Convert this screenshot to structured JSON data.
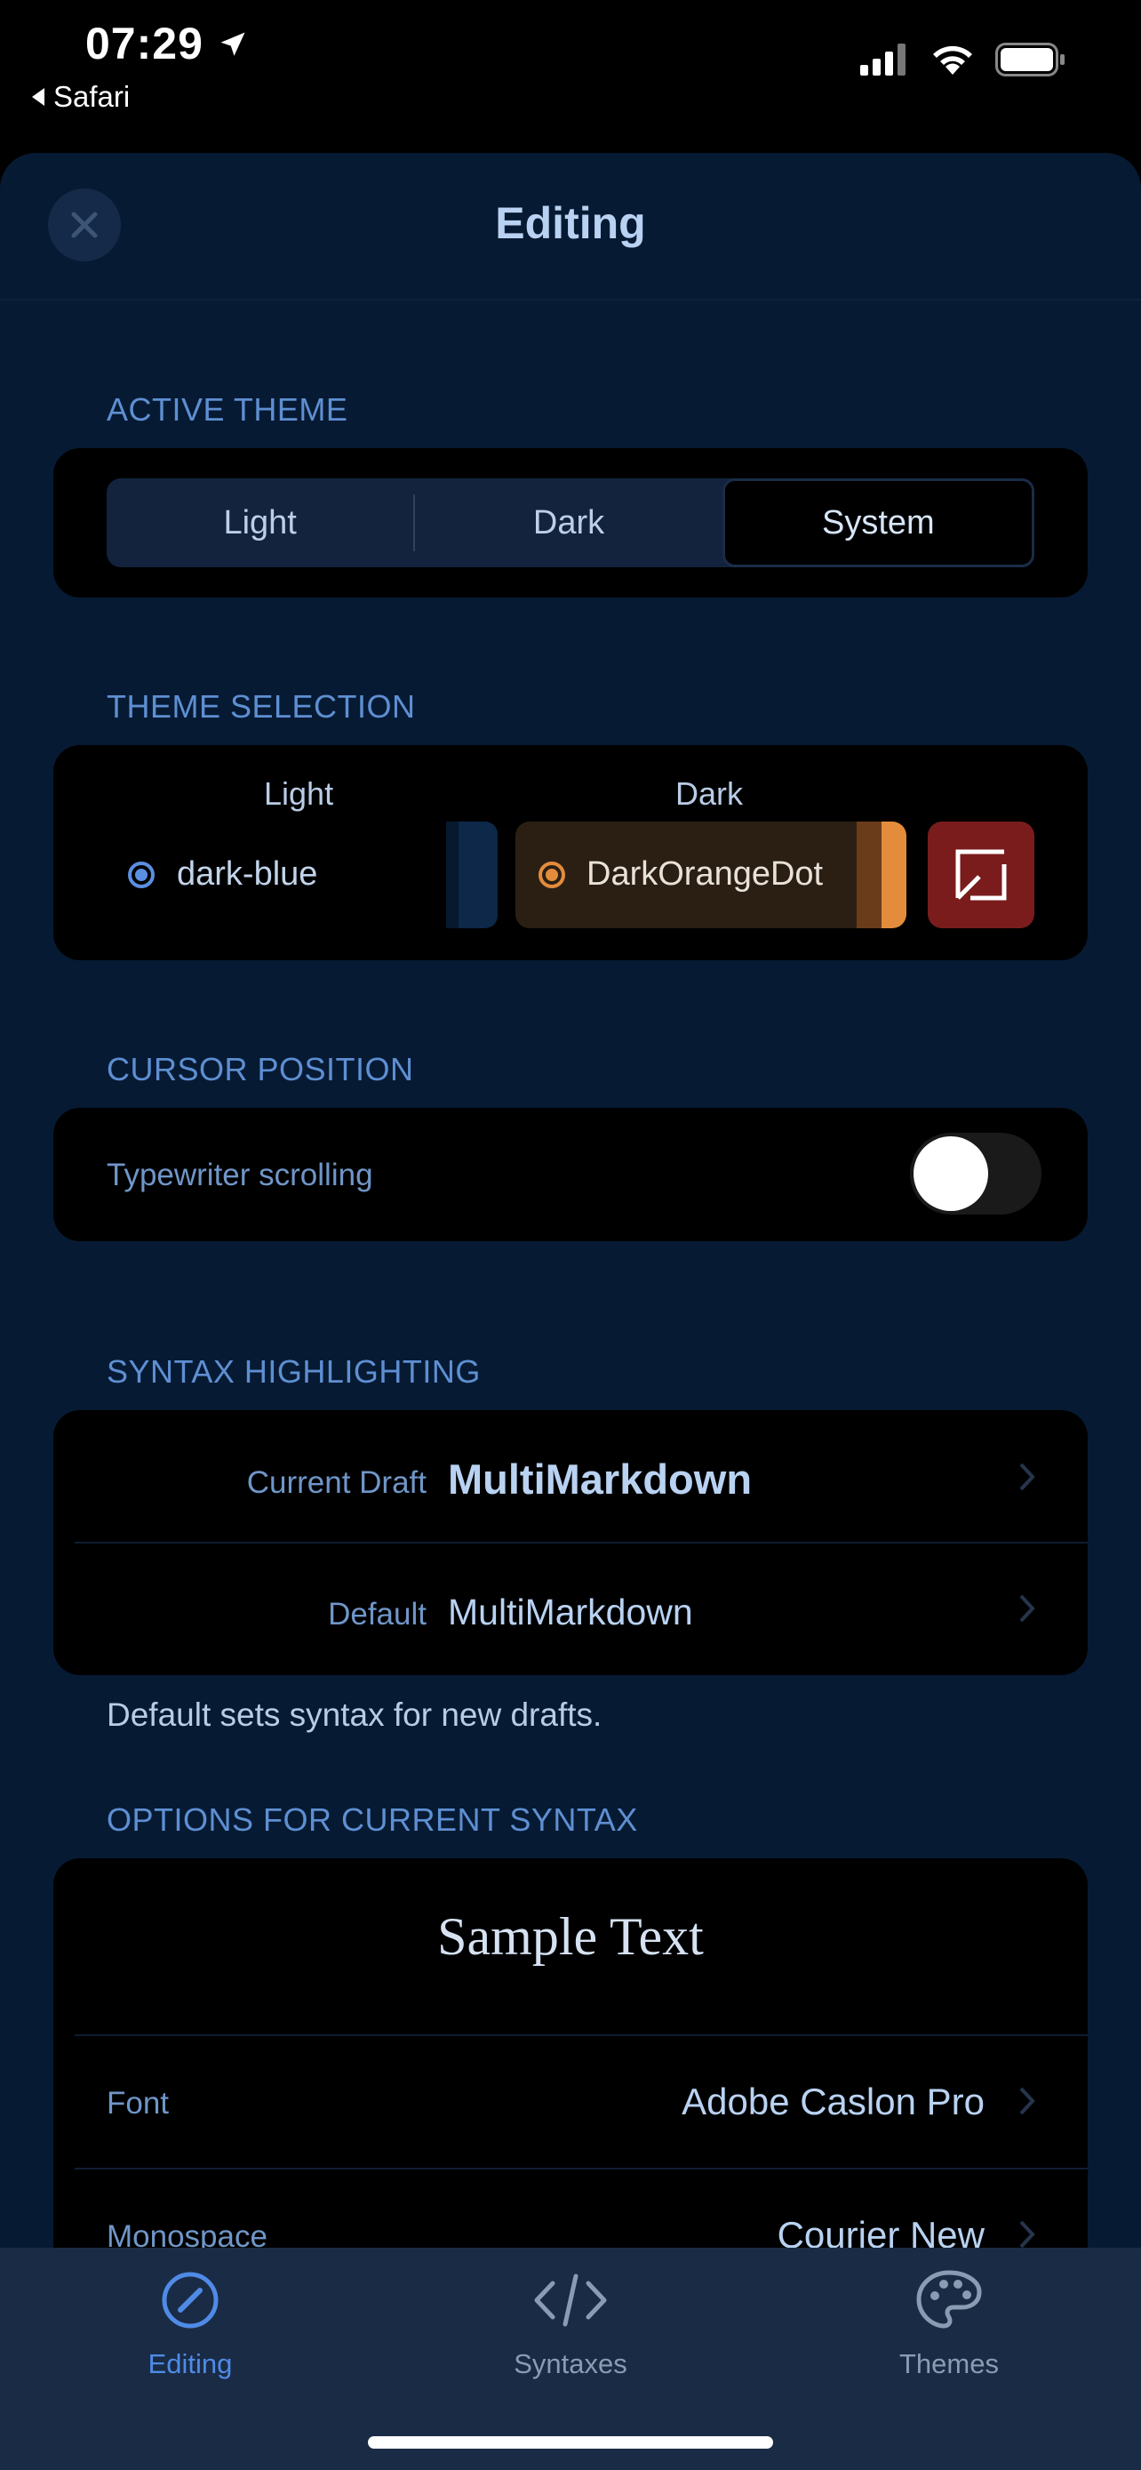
{
  "status_bar": {
    "time": "07:29",
    "back_label": "Safari"
  },
  "nav": {
    "title": "Editing"
  },
  "active_theme": {
    "section_label": "ACTIVE THEME",
    "options": [
      "Light",
      "Dark",
      "System"
    ],
    "selected": "System"
  },
  "theme_selection": {
    "section_label": "THEME SELECTION",
    "light_header": "Light",
    "dark_header": "Dark",
    "light_theme": "dark-blue",
    "dark_theme": "DarkOrangeDot",
    "colors": {
      "light_radio": "#5b8fe0",
      "dark_radio": "#e38c3c",
      "expand_button": "#7a1c1c"
    }
  },
  "cursor_position": {
    "section_label": "CURSOR POSITION",
    "typewriter_label": "Typewriter scrolling",
    "typewriter_on": false
  },
  "syntax_highlighting": {
    "section_label": "SYNTAX HIGHLIGHTING",
    "rows": [
      {
        "key": "Current Draft",
        "value": "MultiMarkdown"
      },
      {
        "key": "Default",
        "value": "MultiMarkdown"
      }
    ],
    "footer": "Default sets syntax for new drafts."
  },
  "options": {
    "section_label": "OPTIONS FOR CURRENT SYNTAX",
    "sample_text": "Sample Text",
    "rows": [
      {
        "key": "Font",
        "value": "Adobe Caslon Pro"
      },
      {
        "key": "Monospace",
        "value": "Courier New"
      }
    ]
  },
  "tabbar": {
    "items": [
      {
        "label": "Editing",
        "icon": "compass-icon",
        "active": true
      },
      {
        "label": "Syntaxes",
        "icon": "code-icon",
        "active": false
      },
      {
        "label": "Themes",
        "icon": "palette-icon",
        "active": false
      }
    ],
    "active_color": "#4f8be6",
    "inactive_color": "#8a9bb3"
  }
}
